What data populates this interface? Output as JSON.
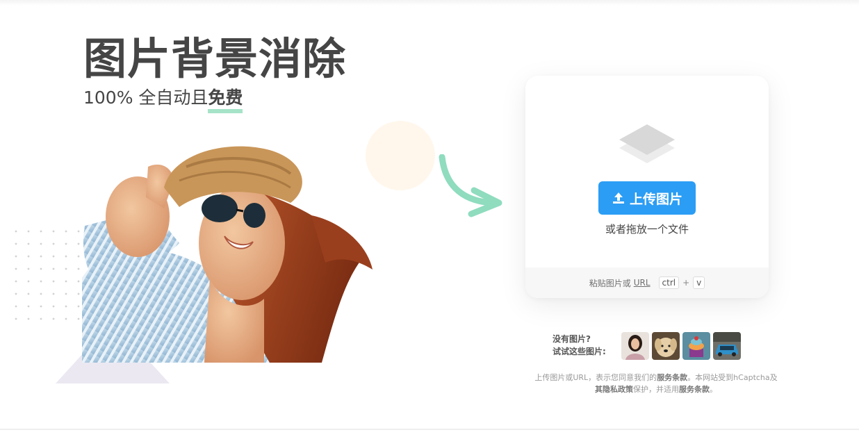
{
  "hero": {
    "title": "图片背景消除",
    "subtitle_prefix": "100% 全自动且",
    "subtitle_emphasis": "免费"
  },
  "upload": {
    "button_label": "上传图片",
    "drop_hint": "或者拖放一个文件",
    "paste_prefix": "粘贴图片或",
    "paste_url": "URL",
    "shortcut_key1": "ctrl",
    "shortcut_plus": "+",
    "shortcut_key2": "v"
  },
  "samples": {
    "prompt_line1": "没有图片?",
    "prompt_line2": "试试这些图片:",
    "thumbnails": [
      "woman-portrait",
      "dog",
      "cake",
      "car"
    ]
  },
  "legal": {
    "line1_prefix": "上传图片或URL，表示您同意我们的",
    "terms_link": "服务条款",
    "line1_suffix": "。本网站受到hCaptcha及",
    "privacy_link": "其隐私政策",
    "line2_middle": "保护，并适用",
    "terms_link2": "服务条款",
    "line2_end": "。"
  },
  "colors": {
    "primary": "#2b9df4",
    "accent_green": "#8fdcbf",
    "underline_green": "#a6e3c8",
    "text_dark": "#454545"
  },
  "icons": {
    "upload_button": "upload-icon",
    "card": "layers-icon",
    "decoration": "curved-arrow-icon"
  }
}
